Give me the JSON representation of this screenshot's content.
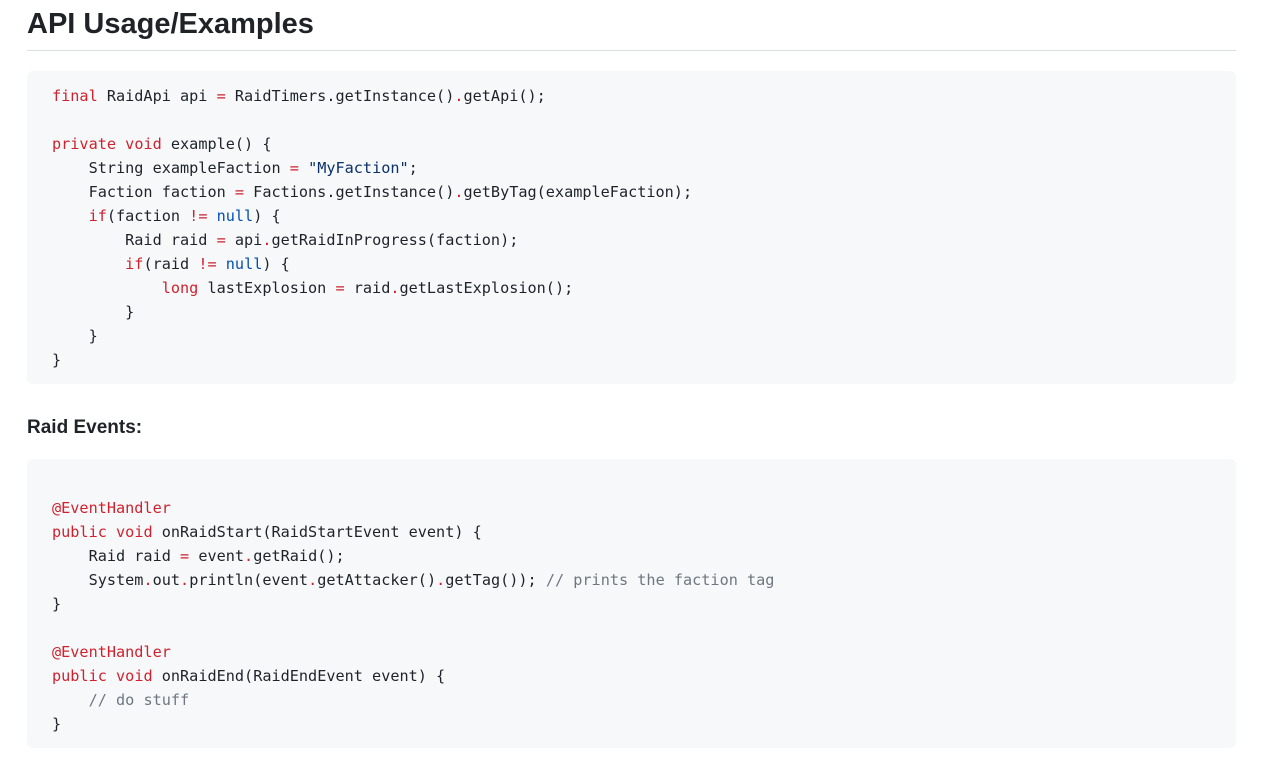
{
  "heading": "API Usage/Examples",
  "subheading": "Raid Events:",
  "code1": [
    [
      [
        "k",
        "final"
      ],
      [
        "t",
        " RaidApi api "
      ],
      [
        "k",
        "="
      ],
      [
        "t",
        " RaidTimers.getInstance()"
      ],
      [
        "k",
        "."
      ],
      [
        "t",
        "getApi();"
      ]
    ],
    [],
    [
      [
        "k",
        "private"
      ],
      [
        "t",
        " "
      ],
      [
        "k",
        "void"
      ],
      [
        "t",
        " example() {"
      ]
    ],
    [
      [
        "t",
        "    String exampleFaction "
      ],
      [
        "k",
        "="
      ],
      [
        "t",
        " "
      ],
      [
        "s",
        "\"MyFaction\""
      ],
      [
        "t",
        ";"
      ]
    ],
    [
      [
        "t",
        "    Faction faction "
      ],
      [
        "k",
        "="
      ],
      [
        "t",
        " Factions.getInstance()"
      ],
      [
        "k",
        "."
      ],
      [
        "t",
        "getByTag(exampleFaction);"
      ]
    ],
    [
      [
        "t",
        "    "
      ],
      [
        "k",
        "if"
      ],
      [
        "t",
        "(faction "
      ],
      [
        "k",
        "!="
      ],
      [
        "t",
        " "
      ],
      [
        "n",
        "null"
      ],
      [
        "t",
        ") {"
      ]
    ],
    [
      [
        "t",
        "        Raid raid "
      ],
      [
        "k",
        "="
      ],
      [
        "t",
        " api"
      ],
      [
        "k",
        "."
      ],
      [
        "t",
        "getRaidInProgress(faction);"
      ]
    ],
    [
      [
        "t",
        "        "
      ],
      [
        "k",
        "if"
      ],
      [
        "t",
        "(raid "
      ],
      [
        "k",
        "!="
      ],
      [
        "t",
        " "
      ],
      [
        "n",
        "null"
      ],
      [
        "t",
        ") {"
      ]
    ],
    [
      [
        "t",
        "            "
      ],
      [
        "k",
        "long"
      ],
      [
        "t",
        " lastExplosion "
      ],
      [
        "k",
        "="
      ],
      [
        "t",
        " raid"
      ],
      [
        "k",
        "."
      ],
      [
        "t",
        "getLastExplosion();"
      ]
    ],
    [
      [
        "t",
        "        }"
      ]
    ],
    [
      [
        "t",
        "    }"
      ]
    ],
    [
      [
        "t",
        "}"
      ]
    ]
  ],
  "code2": [
    [
      [
        "k",
        "@EventHandler"
      ]
    ],
    [
      [
        "k",
        "public"
      ],
      [
        "t",
        " "
      ],
      [
        "k",
        "void"
      ],
      [
        "t",
        " onRaidStart(RaidStartEvent event) {"
      ]
    ],
    [
      [
        "t",
        "    Raid raid "
      ],
      [
        "k",
        "="
      ],
      [
        "t",
        " event"
      ],
      [
        "k",
        "."
      ],
      [
        "t",
        "getRaid();"
      ]
    ],
    [
      [
        "t",
        "    System"
      ],
      [
        "k",
        "."
      ],
      [
        "t",
        "out"
      ],
      [
        "k",
        "."
      ],
      [
        "t",
        "println(event"
      ],
      [
        "k",
        "."
      ],
      [
        "t",
        "getAttacker()"
      ],
      [
        "k",
        "."
      ],
      [
        "t",
        "getTag()); "
      ],
      [
        "c",
        "// prints the faction tag"
      ]
    ],
    [
      [
        "t",
        "}"
      ]
    ],
    [],
    [
      [
        "k",
        "@EventHandler"
      ]
    ],
    [
      [
        "k",
        "public"
      ],
      [
        "t",
        " "
      ],
      [
        "k",
        "void"
      ],
      [
        "t",
        " onRaidEnd(RaidEndEvent event) {"
      ]
    ],
    [
      [
        "t",
        "    "
      ],
      [
        "c",
        "// do stuff"
      ]
    ],
    [
      [
        "t",
        "}"
      ]
    ]
  ],
  "colors": {
    "keyword": "#cf222e",
    "comment": "#6e7781",
    "string": "#0a3069",
    "constant": "#0550ae",
    "code_background": "#f6f8fa"
  }
}
